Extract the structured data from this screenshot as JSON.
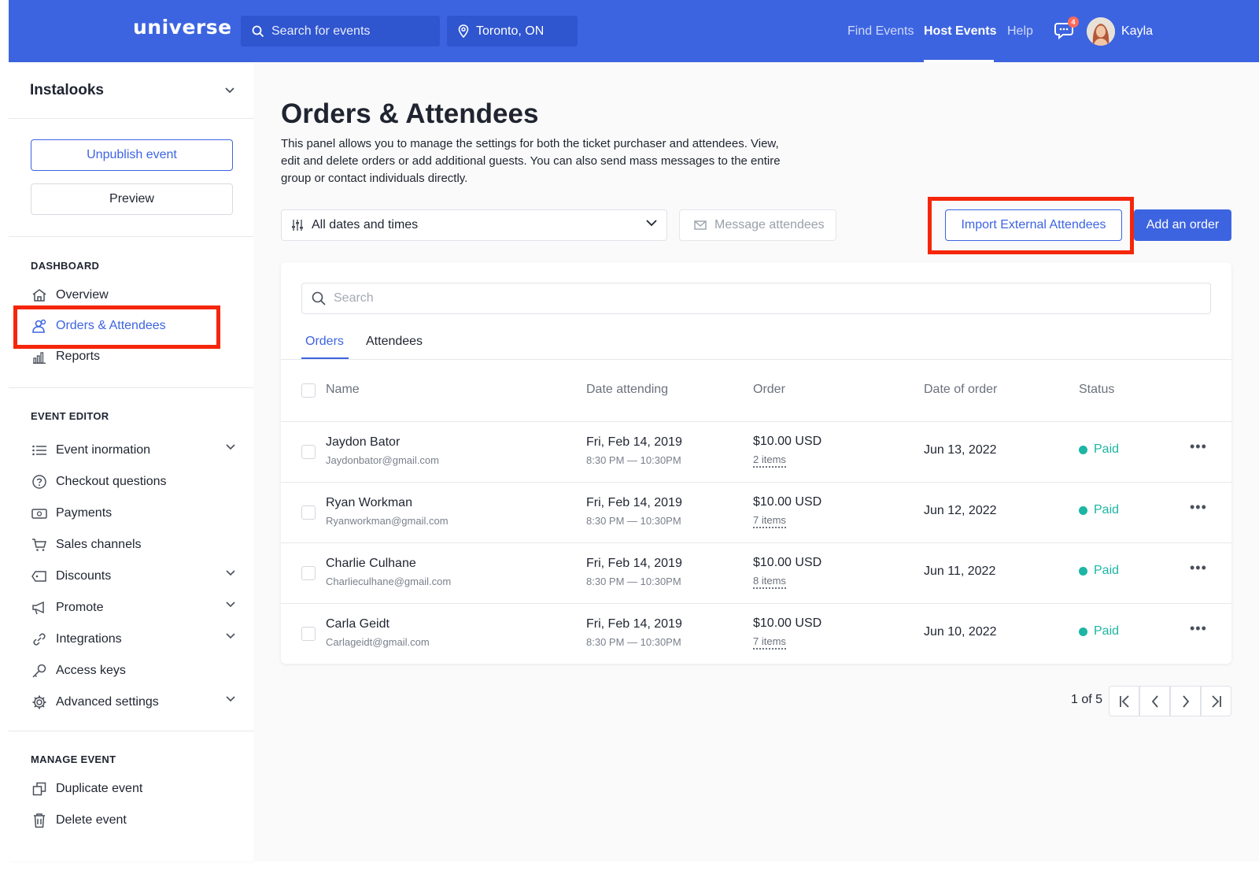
{
  "header": {
    "logo": "universe",
    "search_placeholder": "Search for events",
    "location": "Toronto, ON",
    "nav": [
      "Find Events",
      "Host Events",
      "Help"
    ],
    "active_nav": "Host Events",
    "notification_count": "4",
    "user_name": "Kayla",
    "brand_color": "#3d64e0"
  },
  "sidebar": {
    "event_name": "Instalooks",
    "unpublish_label": "Unpublish event",
    "preview_label": "Preview",
    "dashboard_label": "DASHBOARD",
    "dashboard_items": [
      "Overview",
      "Orders & Attendees",
      "Reports"
    ],
    "editor_label": "EVENT EDITOR",
    "editor_items": [
      "Event inormation",
      "Checkout questions",
      "Payments",
      "Sales channels",
      "Discounts",
      "Promote",
      "Integrations",
      "Access keys",
      "Advanced settings"
    ],
    "manage_label": "MANAGE EVENT",
    "manage_items": [
      "Duplicate event",
      "Delete event"
    ]
  },
  "main": {
    "title": "Orders & Attendees",
    "description": "This panel allows you to manage the settings for both the ticket purchaser and attendees. View, edit and delete orders or add additional guests. You can also send mass messages to the entire group or contact individuals directly.",
    "date_filter": "All dates and times",
    "message_label": "Message attendees",
    "import_label": "Import External Attendees",
    "add_order_label": "Add an order",
    "search_placeholder": "Search",
    "tabs": [
      "Orders",
      "Attendees"
    ],
    "columns": [
      "Name",
      "Date attending",
      "Order",
      "Date of order",
      "Status"
    ],
    "rows": [
      {
        "name": "Jaydon Bator",
        "email": "Jaydonbator@gmail.com",
        "date": "Fri, Feb 14, 2019",
        "time": "8:30 PM — 10:30PM",
        "amount": "$10.00 USD",
        "items": "2 items",
        "order_date": "Jun 13, 2022",
        "status": "Paid"
      },
      {
        "name": "Ryan Workman",
        "email": "Ryanworkman@gmail.com",
        "date": "Fri, Feb 14, 2019",
        "time": "8:30 PM — 10:30PM",
        "amount": "$10.00 USD",
        "items": "7 items",
        "order_date": "Jun 12, 2022",
        "status": "Paid"
      },
      {
        "name": "Charlie Culhane",
        "email": "Charlieculhane@gmail.com",
        "date": "Fri, Feb 14, 2019",
        "time": "8:30 PM — 10:30PM",
        "amount": "$10.00 USD",
        "items": "8 items",
        "order_date": "Jun 11, 2022",
        "status": "Paid"
      },
      {
        "name": "Carla Geidt",
        "email": "Carlageidt@gmail.com",
        "date": "Fri, Feb 14, 2019",
        "time": "8:30 PM — 10:30PM",
        "amount": "$10.00 USD",
        "items": "7 items",
        "order_date": "Jun 10, 2022",
        "status": "Paid"
      }
    ],
    "status_color": "#1db5a3",
    "pagination": "1 of 5"
  }
}
